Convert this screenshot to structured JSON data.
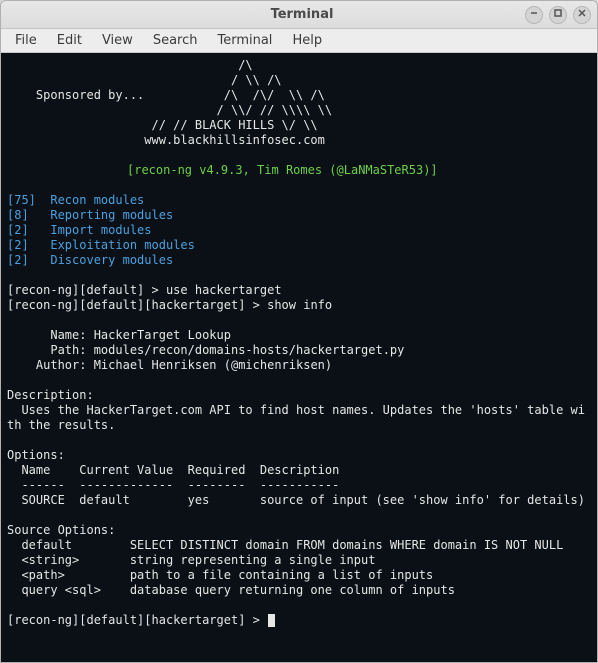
{
  "window": {
    "title": "Terminal"
  },
  "menu": {
    "items": [
      "File",
      "Edit",
      "View",
      "Search",
      "Terminal",
      "Help"
    ]
  },
  "ascii": {
    "l1": "                                /\\",
    "l2": "                               / \\\\ /\\",
    "l3": "    Sponsored by...           /\\  /\\/  \\\\ /\\",
    "l4": "                             / \\\\/ // \\\\\\\\ \\\\",
    "l5": "                    // // BLACK HILLS \\/ \\\\",
    "l6": "                   www.blackhillsinfosec.com"
  },
  "banner": "[recon-ng v4.9.3, Tim Romes (@LaNMaSTeR53)]",
  "modules": [
    {
      "count": "[75]",
      "label": "  Recon modules"
    },
    {
      "count": "[8]",
      "label": "   Reporting modules"
    },
    {
      "count": "[2]",
      "label": "   Import modules"
    },
    {
      "count": "[2]",
      "label": "   Exploitation modules"
    },
    {
      "count": "[2]",
      "label": "   Discovery modules"
    }
  ],
  "prompt1": {
    "pre": "[recon-ng][default] > ",
    "cmd": "use hackertarget"
  },
  "prompt2": {
    "pre": "[recon-ng][default][hackertarget] > ",
    "cmd": "show info"
  },
  "info": {
    "name_label": "      Name: ",
    "name_value": "HackerTarget Lookup",
    "path_label": "      Path: ",
    "path_value": "modules/recon/domains-hosts/hackertarget.py",
    "author_label": "    Author: ",
    "author_value": "Michael Henriksen (@michenriksen)"
  },
  "desc_header": "Description:",
  "desc_body": "  Uses the HackerTarget.com API to find host names. Updates the 'hosts' table wi\nth the results.",
  "options_header": "Options:",
  "options_cols": "  Name    Current Value  Required  Description",
  "options_sep": "  ------  -------------  --------  -----------",
  "options_row": "  SOURCE  default        yes       source of input (see 'show info' for details)",
  "src_header": "Source Options:",
  "src_rows": [
    "  default        SELECT DISTINCT domain FROM domains WHERE domain IS NOT NULL",
    "  <string>       string representing a single input",
    "  <path>         path to a file containing a list of inputs",
    "  query <sql>    database query returning one column of inputs"
  ],
  "prompt3": "[recon-ng][default][hackertarget] > "
}
